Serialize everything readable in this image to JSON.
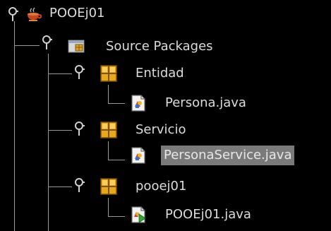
{
  "tree": {
    "project": {
      "label": "POOEj01",
      "expanded": true,
      "children": {
        "source_packages": {
          "label": "Source Packages",
          "expanded": true,
          "packages": [
            {
              "label": "Entidad",
              "expanded": true,
              "files": [
                {
                  "label": "Persona.java",
                  "selected": false,
                  "icon": "java-class-icon"
                }
              ]
            },
            {
              "label": "Servicio",
              "expanded": true,
              "files": [
                {
                  "label": "PersonaService.java",
                  "selected": true,
                  "icon": "java-class-icon"
                }
              ]
            },
            {
              "label": "pooej01",
              "expanded": true,
              "files": [
                {
                  "label": "POOEj01.java",
                  "selected": false,
                  "icon": "java-main-class-icon"
                }
              ]
            }
          ]
        }
      }
    }
  },
  "colors": {
    "background": "#000000",
    "text": "#dcdcdc",
    "selection": "#7a7a7a",
    "guide_line": "#9a9a9a",
    "package_icon": "#e0a020"
  }
}
